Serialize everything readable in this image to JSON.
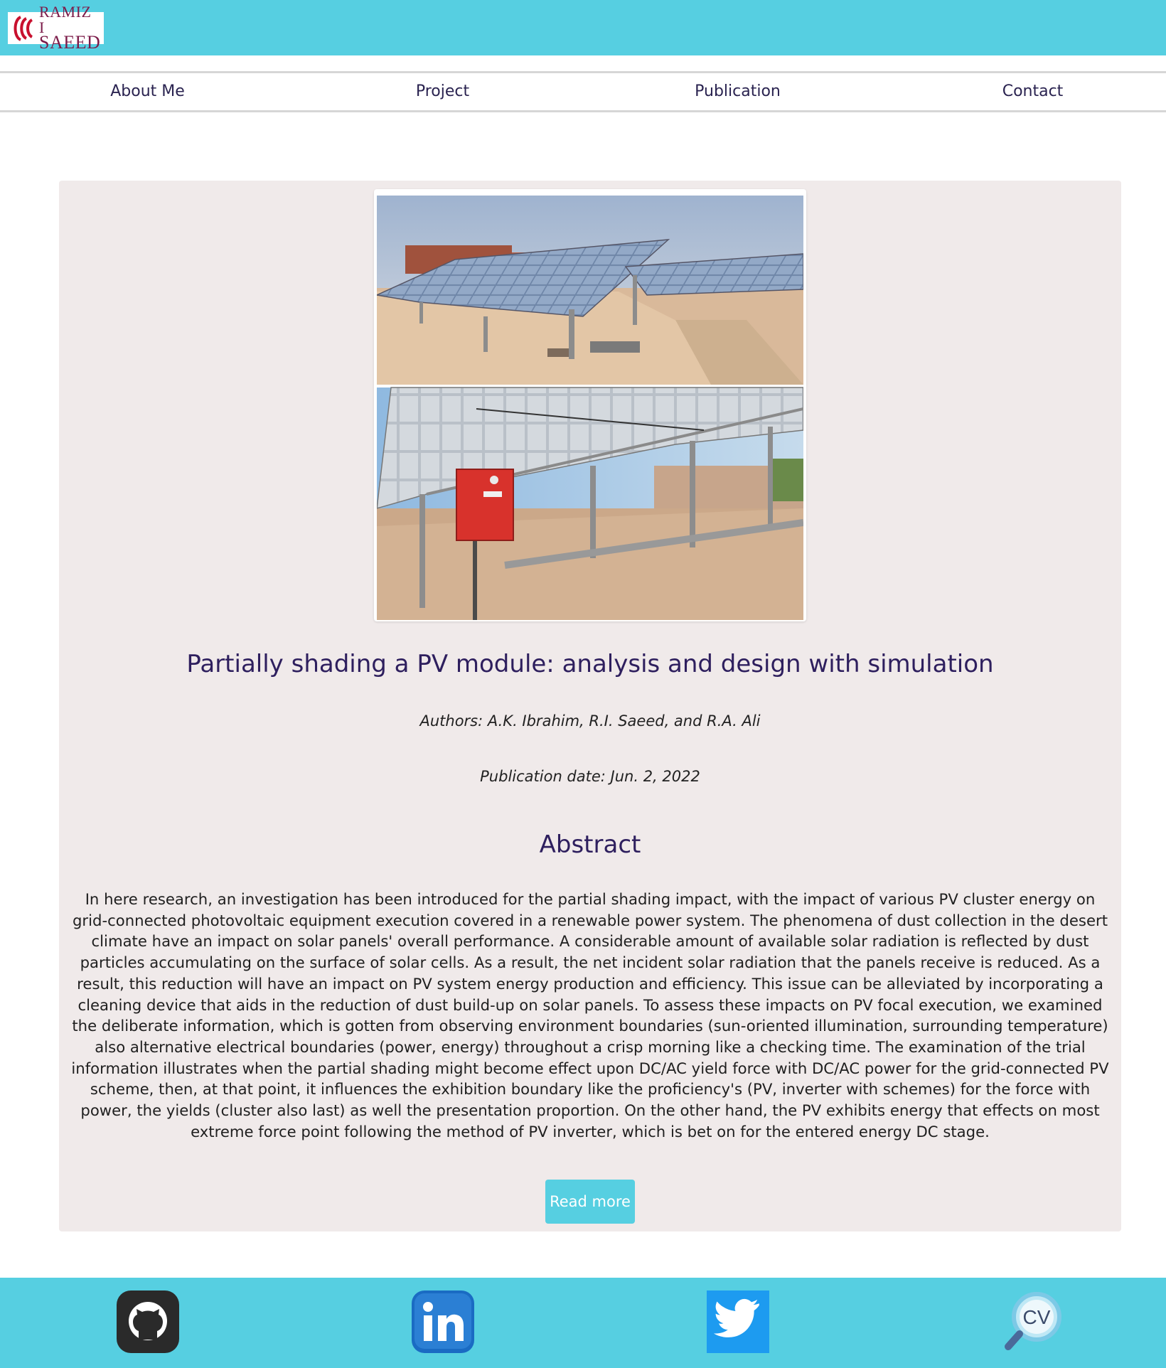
{
  "logo": {
    "line1": "RAMIZ I",
    "line2": "SAEED",
    "icon": "rs-logo-icon"
  },
  "nav": {
    "items": [
      {
        "label": "About Me"
      },
      {
        "label": "Project"
      },
      {
        "label": "Publication"
      },
      {
        "label": "Contact"
      }
    ]
  },
  "publication": {
    "image_icon": "solar-panels-photo",
    "title": "Partially shading a PV module: analysis and design with simulation",
    "authors": "Authors: A.K. Ibrahim, R.I. Saeed, and R.A. Ali",
    "date": "Publication date: Jun. 2, 2022",
    "abstract_heading": "Abstract",
    "abstract": "In here research, an investigation has been introduced for the partial shading impact, with the impact of various PV cluster energy on grid-connected photovoltaic equipment execution covered in a renewable power system. The phenomena of dust collection in the desert climate have an impact on solar panels' overall performance. A considerable amount of available solar radiation is reflected by dust particles accumulating on the surface of solar cells. As a result, the net incident solar radiation that the panels receive is reduced. As a result, this reduction will have an impact on PV system energy production and efficiency. This issue can be alleviated by incorporating a cleaning device that aids in the reduction of dust build-up on solar panels. To assess these impacts on PV focal execution, we examined the deliberate information, which is gotten from observing environment boundaries (sun-oriented illumination, surrounding temperature) also alternative electrical boundaries (power, energy) throughout a crisp morning like a checking time. The examination of the trial information illustrates when the partial shading might become effect upon DC/AC yield force with DC/AC power for the grid-connected PV scheme, then, at that point, it influences the exhibition boundary like the proficiency's (PV, inverter with schemes) for the force with power, the yields (cluster also last) as well the presentation proportion. On the other hand, the PV exhibits energy that effects on most extreme force point following the method of PV inverter, which is bet on for the entered energy DC stage.",
    "read_more_label": "Read more"
  },
  "footer": {
    "links": [
      {
        "icon": "github-icon"
      },
      {
        "icon": "linkedin-icon"
      },
      {
        "icon": "twitter-icon"
      },
      {
        "icon": "cv-icon",
        "label": "CV"
      }
    ]
  },
  "colors": {
    "accent": "#56cfe1",
    "heading": "#2e1f5e",
    "card_background": "#f0eaea",
    "logo": "#7c1c4a"
  }
}
